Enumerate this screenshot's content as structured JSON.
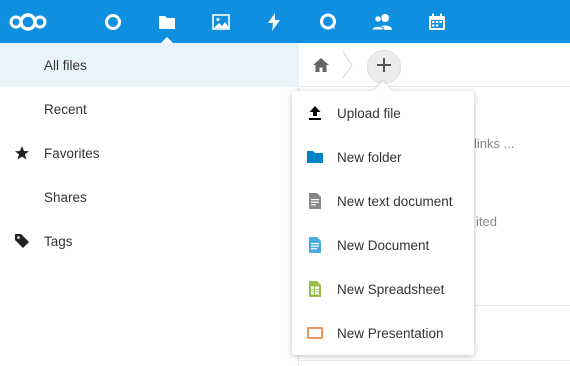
{
  "header": {
    "apps": [
      {
        "name": "nextcloud-logo-icon"
      },
      {
        "name": "dashboard-icon"
      },
      {
        "name": "files-icon"
      },
      {
        "name": "photos-icon"
      },
      {
        "name": "activity-icon"
      },
      {
        "name": "talk-icon"
      },
      {
        "name": "contacts-icon"
      },
      {
        "name": "calendar-icon"
      }
    ],
    "accent": "#0f8fdf"
  },
  "sidebar": {
    "items": [
      {
        "label": "All files",
        "icon": "",
        "active": true
      },
      {
        "label": "Recent",
        "icon": ""
      },
      {
        "label": "Favorites",
        "icon": "star-icon"
      },
      {
        "label": "Shares",
        "icon": ""
      },
      {
        "label": "Tags",
        "icon": "tag-icon"
      }
    ],
    "active_bg": "#e9f3fb"
  },
  "breadcrumb": {
    "home_icon": "home-icon",
    "add_icon": "plus-icon"
  },
  "background": {
    "partial_text_1": "links ...",
    "partial_text_2": "ited"
  },
  "new_menu": {
    "items": [
      {
        "label": "Upload file",
        "icon": "upload-icon",
        "color": "#000000"
      },
      {
        "label": "New folder",
        "icon": "folder-icon",
        "color": "#0082c9"
      },
      {
        "label": "New text document",
        "icon": "text-document-icon",
        "color": "#888888"
      },
      {
        "label": "New Document",
        "icon": "document-icon",
        "color": "#49abe0"
      },
      {
        "label": "New Spreadsheet",
        "icon": "spreadsheet-icon",
        "color": "#9abd4e"
      },
      {
        "label": "New Presentation",
        "icon": "presentation-icon",
        "color": "#f0965f"
      }
    ]
  }
}
